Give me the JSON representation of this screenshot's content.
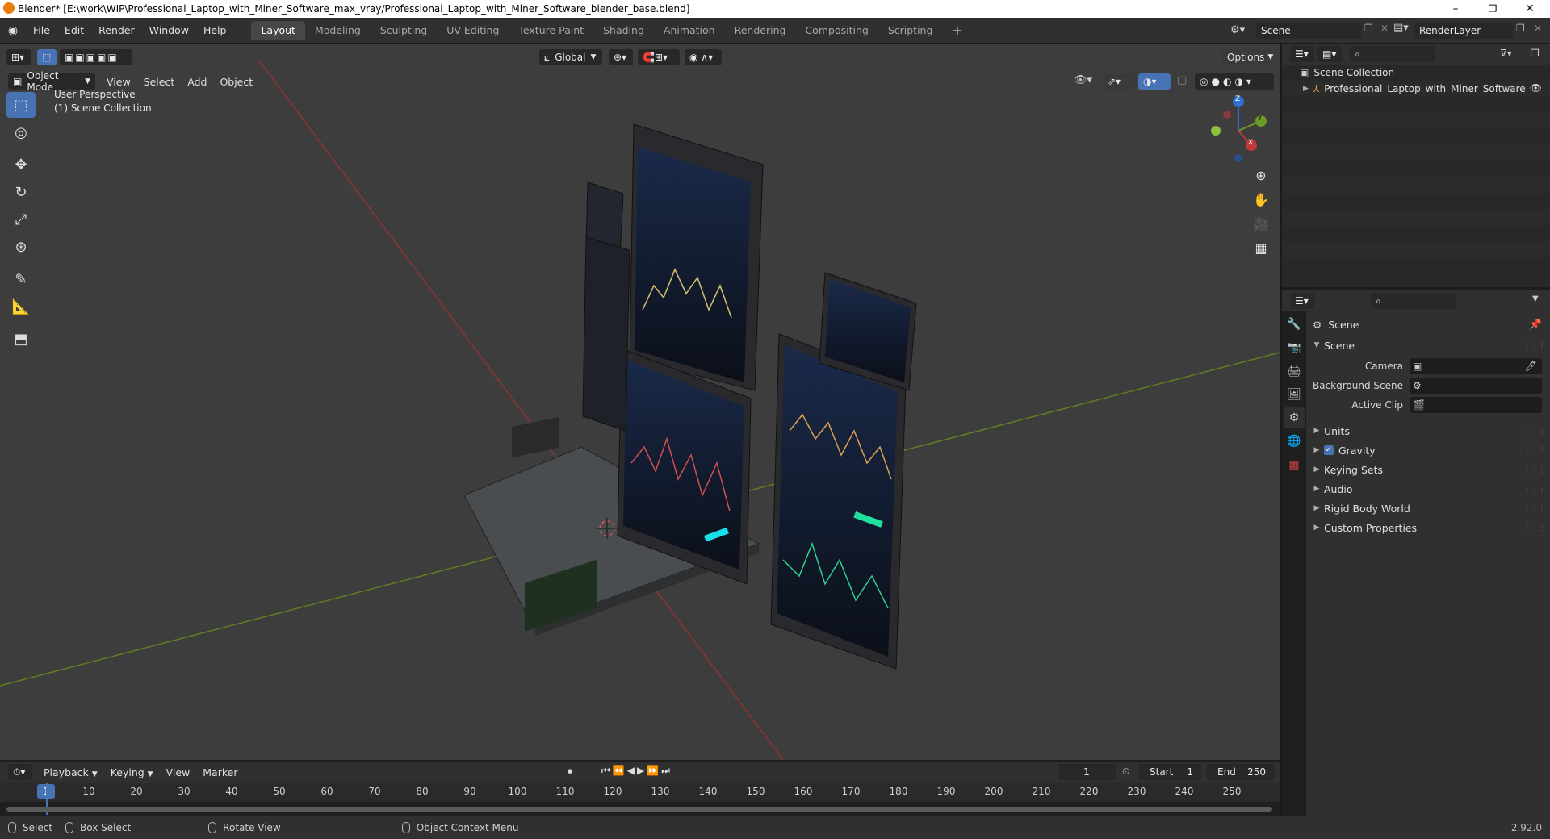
{
  "window": {
    "title": "Blender* [E:\\work\\WIP\\Professional_Laptop_with_Miner_Software_max_vray/Professional_Laptop_with_Miner_Software_blender_base.blend]",
    "minimize": "–",
    "restore": "❐",
    "close": "✕"
  },
  "menu": [
    "File",
    "Edit",
    "Render",
    "Window",
    "Help"
  ],
  "workspaces": [
    "Layout",
    "Modeling",
    "Sculpting",
    "UV Editing",
    "Texture Paint",
    "Shading",
    "Animation",
    "Rendering",
    "Compositing",
    "Scripting"
  ],
  "workspace_add": "+",
  "scene_field": "Scene",
  "renderlayer_field": "RenderLayer",
  "viewport": {
    "transform_orientation": "Global",
    "options_label": "Options",
    "mode": "Object Mode",
    "menus": [
      "View",
      "Select",
      "Add",
      "Object"
    ],
    "perspective": "User Perspective",
    "collection": "(1) Scene Collection",
    "gizmo_axes": {
      "z": "Z",
      "y": "Y",
      "x": "X"
    }
  },
  "outliner": {
    "scene_collection": "Scene Collection",
    "object": "Professional_Laptop_with_Miner_Software"
  },
  "properties": {
    "header": "Scene",
    "panel": "Scene",
    "camera_label": "Camera",
    "background_scene_label": "Background Scene",
    "active_clip_label": "Active Clip",
    "subpanels": [
      "Units",
      "Gravity",
      "Keying Sets",
      "Audio",
      "Rigid Body World",
      "Custom Properties"
    ],
    "gravity_checked": true
  },
  "timeline": {
    "menus": [
      "Playback",
      "Keying",
      "View",
      "Marker"
    ],
    "current_frame": "1",
    "start_label": "Start",
    "start_value": "1",
    "end_label": "End",
    "end_value": "250",
    "ticks": [
      "1",
      "10",
      "20",
      "30",
      "40",
      "50",
      "60",
      "70",
      "80",
      "90",
      "100",
      "110",
      "120",
      "130",
      "140",
      "150",
      "160",
      "170",
      "180",
      "190",
      "200",
      "210",
      "220",
      "230",
      "240",
      "250"
    ]
  },
  "statusbar": {
    "select": "Select",
    "box_select": "Box Select",
    "rotate_view": "Rotate View",
    "context_menu": "Object Context Menu",
    "version": "2.92.0"
  },
  "colors": {
    "accent": "#4772b3",
    "x_axis": "#c0393b",
    "y_axis": "#6a9a27",
    "z_axis": "#2f6fd6"
  }
}
